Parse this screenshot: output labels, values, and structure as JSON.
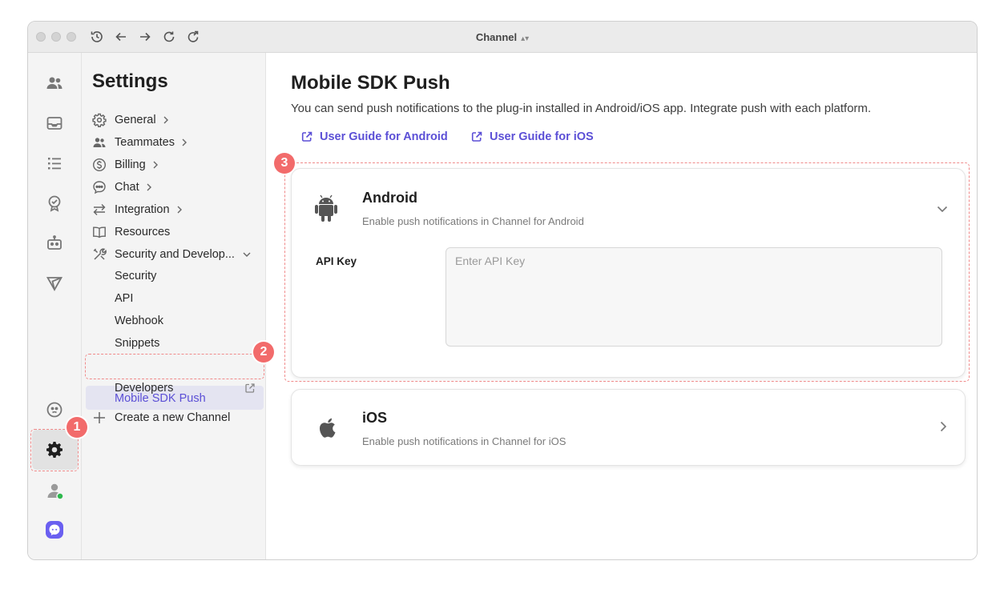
{
  "window": {
    "title": "Channel"
  },
  "sidebar": {
    "title": "Settings",
    "items": [
      {
        "label": "General",
        "icon": "gear-icon",
        "arrow": "chevron-right-icon"
      },
      {
        "label": "Teammates",
        "icon": "people-icon",
        "arrow": "chevron-right-icon"
      },
      {
        "label": "Billing",
        "icon": "dollar-icon",
        "arrow": "chevron-right-icon"
      },
      {
        "label": "Chat",
        "icon": "chat-bubble-icon",
        "arrow": "chevron-right-icon"
      },
      {
        "label": "Integration",
        "icon": "arrows-icon",
        "arrow": "chevron-right-icon"
      },
      {
        "label": "Resources",
        "icon": "book-icon"
      },
      {
        "label": "Security and Develop...",
        "icon": "tools-icon",
        "arrow": "chevron-down-icon"
      }
    ],
    "subitems": [
      "Security",
      "API",
      "Webhook",
      "Snippets",
      "Mobile SDK Push",
      "Developers"
    ],
    "active": "Mobile SDK Push",
    "create_channel": "Create a new Channel"
  },
  "main": {
    "title": "Mobile SDK Push",
    "description": "You can send push notifications to the plug-in installed in Android/iOS app. Integrate push with each platform.",
    "guides": [
      "User Guide for Android",
      "User Guide for iOS"
    ],
    "android": {
      "title": "Android",
      "subtitle": "Enable push notifications in Channel for Android",
      "api_key_label": "API Key",
      "api_key_placeholder": "Enter API Key",
      "api_key_value": ""
    },
    "ios": {
      "title": "iOS",
      "subtitle": "Enable push notifications in Channel for iOS"
    }
  },
  "annotations": [
    "1",
    "2",
    "3"
  ],
  "colors": {
    "accent": "#5b4fd6",
    "badge": "#f26b6b",
    "online": "#2db84d"
  }
}
